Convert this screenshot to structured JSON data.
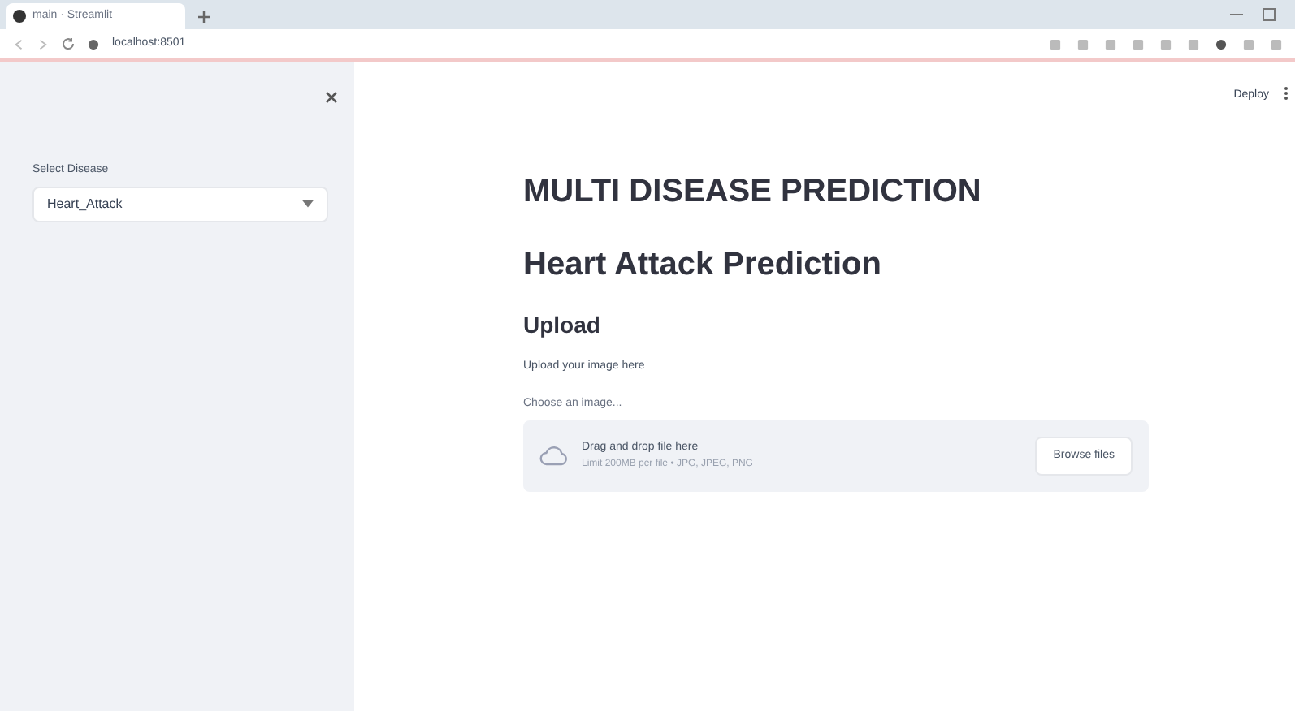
{
  "browser": {
    "tab_title": "main · Streamlit",
    "address": "localhost:8501"
  },
  "sidebar": {
    "select_label": "Select Disease",
    "select_value": "Heart_Attack"
  },
  "header": {
    "deploy": "Deploy"
  },
  "main": {
    "title": "MULTI DISEASE PREDICTION",
    "subtitle": "Heart Attack Prediction",
    "section": "Upload",
    "caption": "Upload your image here",
    "uploader_label": "Choose an image...",
    "dropzone": {
      "text": "Drag and drop file here",
      "limit": "Limit 200MB per file • JPG, JPEG, PNG",
      "button": "Browse files"
    }
  }
}
